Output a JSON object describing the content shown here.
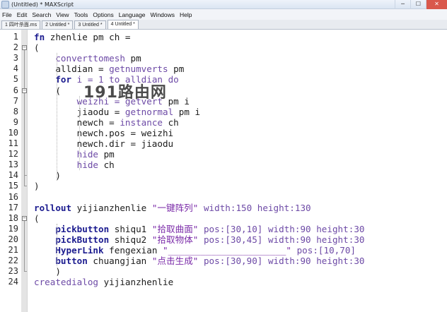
{
  "window": {
    "title": "(Untitled) * MAXScript",
    "min": "─",
    "max": "☐",
    "close": "✕"
  },
  "menu": [
    "File",
    "Edit",
    "Search",
    "View",
    "Tools",
    "Options",
    "Language",
    "Windows",
    "Help"
  ],
  "tabs": [
    "1 四叶杀面.ms",
    "2 Untitled *",
    "3 Untitled *",
    "4 Untitled *"
  ],
  "active_tab_index": 3,
  "watermark": "191路由网",
  "line_numbers": [
    "1",
    "2",
    "3",
    "4",
    "5",
    "6",
    "7",
    "8",
    "9",
    "10",
    "11",
    "12",
    "13",
    "14",
    "15",
    "16",
    "17",
    "18",
    "19",
    "20",
    "21",
    "22",
    "23",
    "24"
  ],
  "code": [
    [
      [
        "kw",
        "fn"
      ],
      [
        "id",
        " zhenlie pm ch ="
      ]
    ],
    [
      [
        "op",
        "("
      ]
    ],
    [
      [
        "id",
        "    "
      ],
      [
        "fn",
        "converttomesh"
      ],
      [
        "id",
        " pm"
      ]
    ],
    [
      [
        "id",
        "    alldian = "
      ],
      [
        "fn",
        "getnumverts"
      ],
      [
        "id",
        " pm"
      ]
    ],
    [
      [
        "id",
        "    "
      ],
      [
        "kw",
        "for"
      ],
      [
        "fn",
        " i = 1 to alldian do"
      ]
    ],
    [
      [
        "id",
        "    ("
      ]
    ],
    [
      [
        "id",
        "        "
      ],
      [
        "fn",
        "weizhi = getvert"
      ],
      [
        "id",
        " pm i"
      ]
    ],
    [
      [
        "id",
        "        jiaodu = "
      ],
      [
        "fn",
        "getnormal"
      ],
      [
        "id",
        " pm i"
      ]
    ],
    [
      [
        "id",
        "        newch = "
      ],
      [
        "fn",
        "instance"
      ],
      [
        "id",
        " ch"
      ]
    ],
    [
      [
        "id",
        "        newch.pos = weizhi"
      ]
    ],
    [
      [
        "id",
        "        newch.dir = jiaodu"
      ]
    ],
    [
      [
        "id",
        "        "
      ],
      [
        "fn",
        "hide"
      ],
      [
        "id",
        " pm"
      ]
    ],
    [
      [
        "id",
        "        "
      ],
      [
        "fn",
        "hide"
      ],
      [
        "id",
        " ch"
      ]
    ],
    [
      [
        "id",
        "    )"
      ]
    ],
    [
      [
        "op",
        ")"
      ]
    ],
    [],
    [
      [
        "kw",
        "rollout"
      ],
      [
        "id",
        " yijianzhenlie "
      ],
      [
        "str",
        "\"一键阵列\""
      ],
      [
        "fn",
        " width:"
      ],
      [
        "num",
        "150"
      ],
      [
        "fn",
        " height:"
      ],
      [
        "num",
        "130"
      ]
    ],
    [
      [
        "op",
        "("
      ]
    ],
    [
      [
        "id",
        "    "
      ],
      [
        "kw",
        "pickbutton"
      ],
      [
        "id",
        " shiqu1 "
      ],
      [
        "str",
        "\"拾取曲面\""
      ],
      [
        "fn",
        " pos:"
      ],
      [
        "num",
        "[30,10]"
      ],
      [
        "fn",
        " width:"
      ],
      [
        "num",
        "90"
      ],
      [
        "fn",
        " height:"
      ],
      [
        "num",
        "30"
      ]
    ],
    [
      [
        "id",
        "    "
      ],
      [
        "kw",
        "pickButton"
      ],
      [
        "id",
        " shiqu2 "
      ],
      [
        "str",
        "\"拾取物体\""
      ],
      [
        "fn",
        " pos:"
      ],
      [
        "num",
        "[30,45]"
      ],
      [
        "fn",
        " width:"
      ],
      [
        "num",
        "90"
      ],
      [
        "fn",
        " height:"
      ],
      [
        "num",
        "30"
      ]
    ],
    [
      [
        "id",
        "    "
      ],
      [
        "kw",
        "HyperLink"
      ],
      [
        "id",
        " fengexian "
      ],
      [
        "str",
        "\"______________________\""
      ],
      [
        "fn",
        " pos:"
      ],
      [
        "num",
        "[10,70]"
      ]
    ],
    [
      [
        "id",
        "    "
      ],
      [
        "kw",
        "button"
      ],
      [
        "id",
        " chuangjian "
      ],
      [
        "str",
        "\"点击生成\""
      ],
      [
        "fn",
        " pos:"
      ],
      [
        "num",
        "[30,90]"
      ],
      [
        "fn",
        " width:"
      ],
      [
        "num",
        "90"
      ],
      [
        "fn",
        " height:"
      ],
      [
        "num",
        "30"
      ]
    ],
    [
      [
        "id",
        "    )"
      ]
    ],
    [
      [
        "fn",
        "createdialog"
      ],
      [
        "id",
        " yijianzhenlie"
      ]
    ]
  ]
}
